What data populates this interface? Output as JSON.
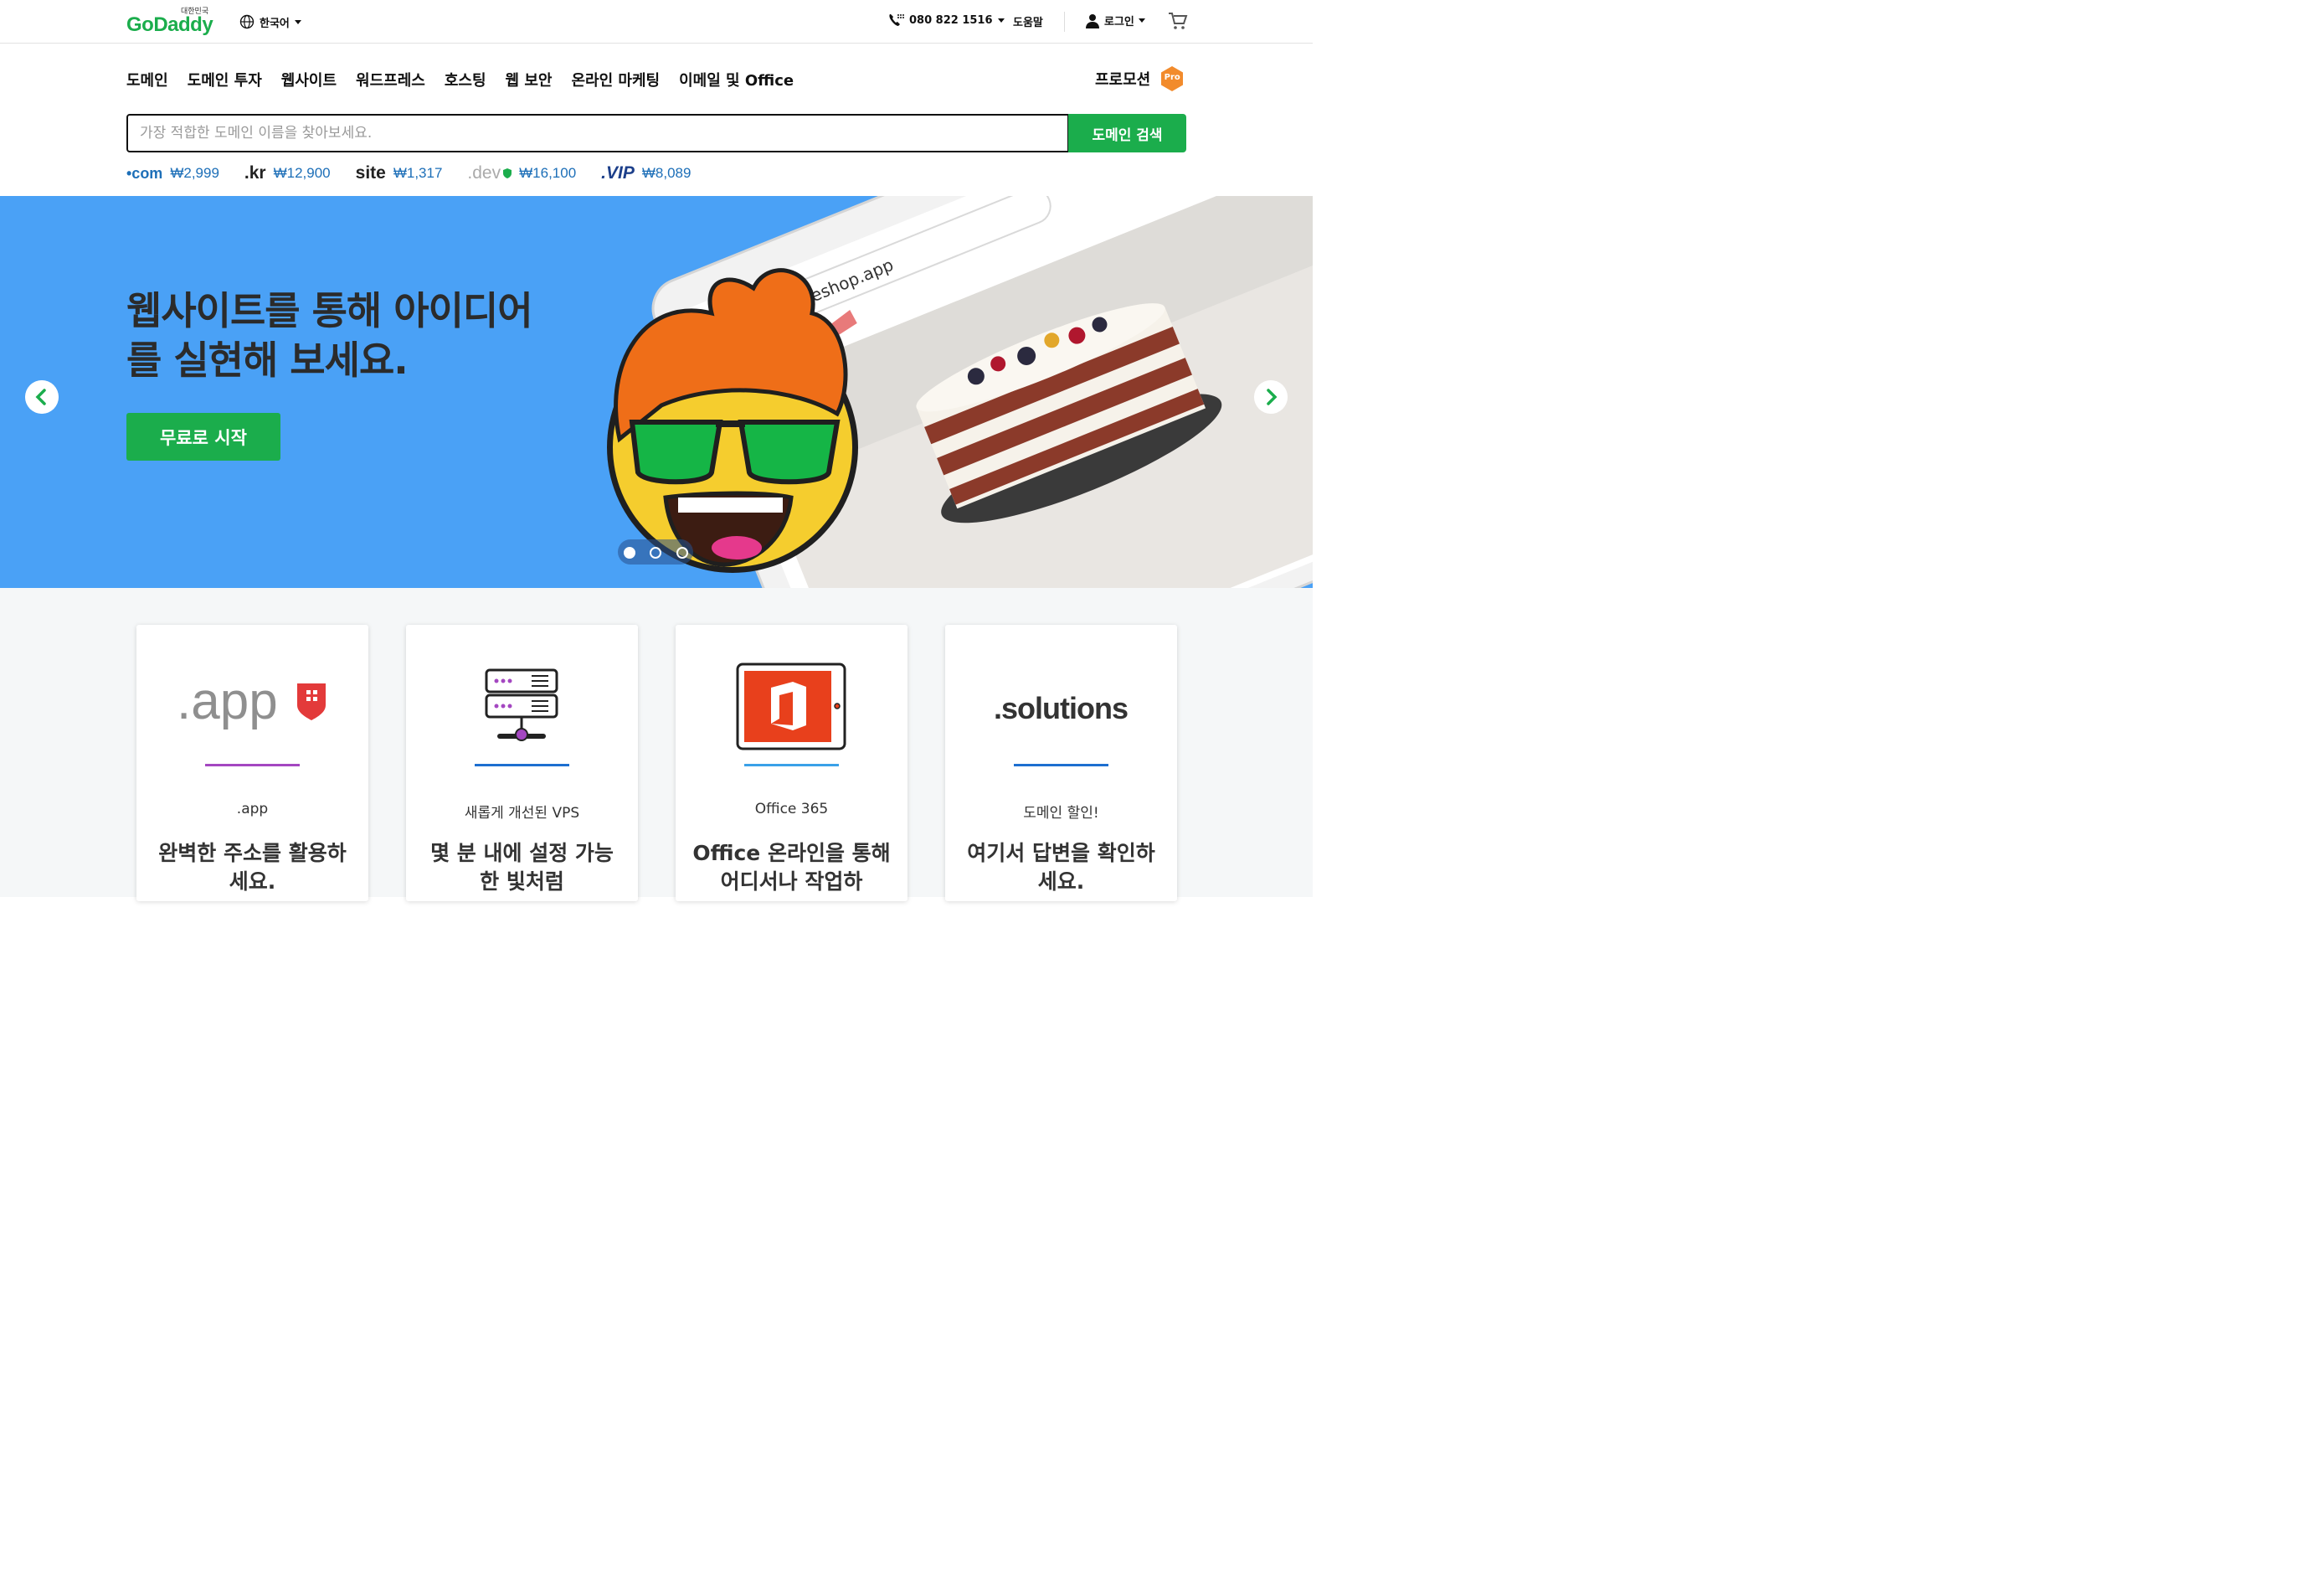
{
  "header": {
    "logo_country": "대한민국",
    "logo_brand": "GoDaddy",
    "language": "한국어",
    "phone": "080 822 1516",
    "help": "도움말",
    "login": "로그인"
  },
  "nav": {
    "items": [
      "도메인",
      "도메인 투자",
      "웹사이트",
      "워드프레스",
      "호스팅",
      "웹 보안",
      "온라인 마케팅",
      "이메일 및 Office"
    ],
    "promo": "프로모션",
    "pro_badge": "Pro"
  },
  "search": {
    "placeholder": "가장 적합한 도메인 이름을 찾아보세요.",
    "button": "도메인 검색"
  },
  "tlds": [
    {
      "name": "•com",
      "price": "₩2,999"
    },
    {
      "name": ".kr",
      "price": "₩12,900"
    },
    {
      "name": "site",
      "price": "₩1,317"
    },
    {
      "name": ".dev",
      "price": "₩16,100"
    },
    {
      "name": ".VIP",
      "price": "₩8,089"
    }
  ],
  "hero": {
    "title_line1": "웹사이트를 통해 아이디어",
    "title_line2": "를 실현해 보세요.",
    "cta": "무료로 시작",
    "browser_url": "mycakeshop.app",
    "slide_count": 3,
    "active_slide": 1
  },
  "cards": [
    {
      "art_text": ".app",
      "kicker": ".app",
      "title": "완벽한 주소를 활용하세요.",
      "rule_color": "#a447c1"
    },
    {
      "art_text": "",
      "kicker": "새롭게 개선된 VPS",
      "title": "몇 분 내에 설정 가능한 빛처럼",
      "rule_color": "#1d6fd0"
    },
    {
      "art_text": "",
      "kicker": "Office 365",
      "title": "Office 온라인을 통해 어디서나 작업하",
      "rule_color": "#3aa1e8"
    },
    {
      "art_text": ".solutions",
      "kicker": "도메인 할인!",
      "title": "여기서 답변을 확인하세요.",
      "rule_color": "#1d6fd0"
    }
  ],
  "colors": {
    "brand_green": "#1bad4c",
    "hero_blue": "#4aa1f6",
    "link_blue": "#1d6fb8",
    "pro_orange": "#f28b2c"
  }
}
